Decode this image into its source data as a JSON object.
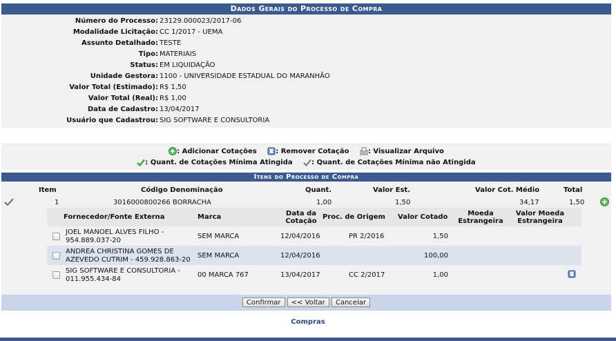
{
  "dados": {
    "title": "Dados Gerais do Processo de Compra",
    "fields": [
      {
        "label": "Número do Processo:",
        "value": "23129.000023/2017-06"
      },
      {
        "label": "Modalidade Licitação:",
        "value": "CC 1/2017 - UEMA"
      },
      {
        "label": "Assunto Detalhado:",
        "value": "TESTE"
      },
      {
        "label": "Tipo:",
        "value": "MATERIAIS"
      },
      {
        "label": "Status:",
        "value": "EM LIQUIDAÇÃO"
      },
      {
        "label": "Unidade Gestora:",
        "value": "1100 - UNIVERSIDADE ESTADUAL DO MARANHÃO"
      },
      {
        "label": "Valor Total (Estimado):",
        "value": "R$ 1,50"
      },
      {
        "label": "Valor Total (Real):",
        "value": "R$ 1,00"
      },
      {
        "label": "Data de Cadastro:",
        "value": "13/04/2017"
      },
      {
        "label": "Usuário que Cadastrou:",
        "value": "SIG SOFTWARE E CONSULTORIA"
      }
    ]
  },
  "legenda": {
    "adicionar": ": Adicionar Cotações",
    "remover": ": Remover Cotação",
    "visualizar": ": Visualizar Arquivo",
    "minima_atingida": ": Quant. de Cotações Mínima Atingida",
    "minima_nao_atingida": ": Quant. de Cotações Mínima não Atingida"
  },
  "itens": {
    "title": "Itens do Processo de Compra",
    "headers": {
      "item": "Item",
      "codigo": "Código Denominação",
      "quant": "Quant.",
      "valor_est": "Valor Est.",
      "valor_cot_medio": "Valor Cot. Médio",
      "total": "Total"
    },
    "row": {
      "item": "1",
      "codigo": "3016000800266 BORRACHA",
      "quant": "1,00",
      "valor_est": "1,50",
      "valor_cot_medio": "34,17",
      "total": "1,50"
    },
    "cotacoes": {
      "headers": {
        "fornecedor": "Fornecedor/Fonte Externa",
        "marca": "Marca",
        "data": "Data da Cotação",
        "proc": "Proc. de Origem",
        "valor": "Valor Cotado",
        "moeda": "Moeda Estrangeira",
        "valor_moeda": "Valor Moeda Estrangeira"
      },
      "rows": [
        {
          "fornecedor": "JOEL MANOEL ALVES FILHO - 954.889.037-20",
          "marca": "SEM MARCA",
          "data": "12/04/2016",
          "proc": "PR 2/2016",
          "valor": "1,50"
        },
        {
          "fornecedor": "ANDREA CHRISTINA GOMES DE AZEVEDO CUTRIM - 459.928.863-20",
          "marca": "SEM MARCA",
          "data": "12/04/2016",
          "proc": "",
          "valor": "100,00"
        },
        {
          "fornecedor": "SIG SOFTWARE E CONSULTORIA - 011.955.434-84",
          "marca": "00 MARCA 767",
          "data": "13/04/2017",
          "proc": "CC 2/2017",
          "valor": "1,00"
        }
      ]
    }
  },
  "buttons": {
    "confirmar": "Confirmar",
    "voltar": "<< Voltar",
    "cancelar": "Cancelar"
  },
  "footer": {
    "link": "Compras"
  },
  "colors": {
    "header_blue": "#3b5a8f",
    "alt_row": "#dce3ee",
    "button_bar": "#c8d5ea"
  }
}
